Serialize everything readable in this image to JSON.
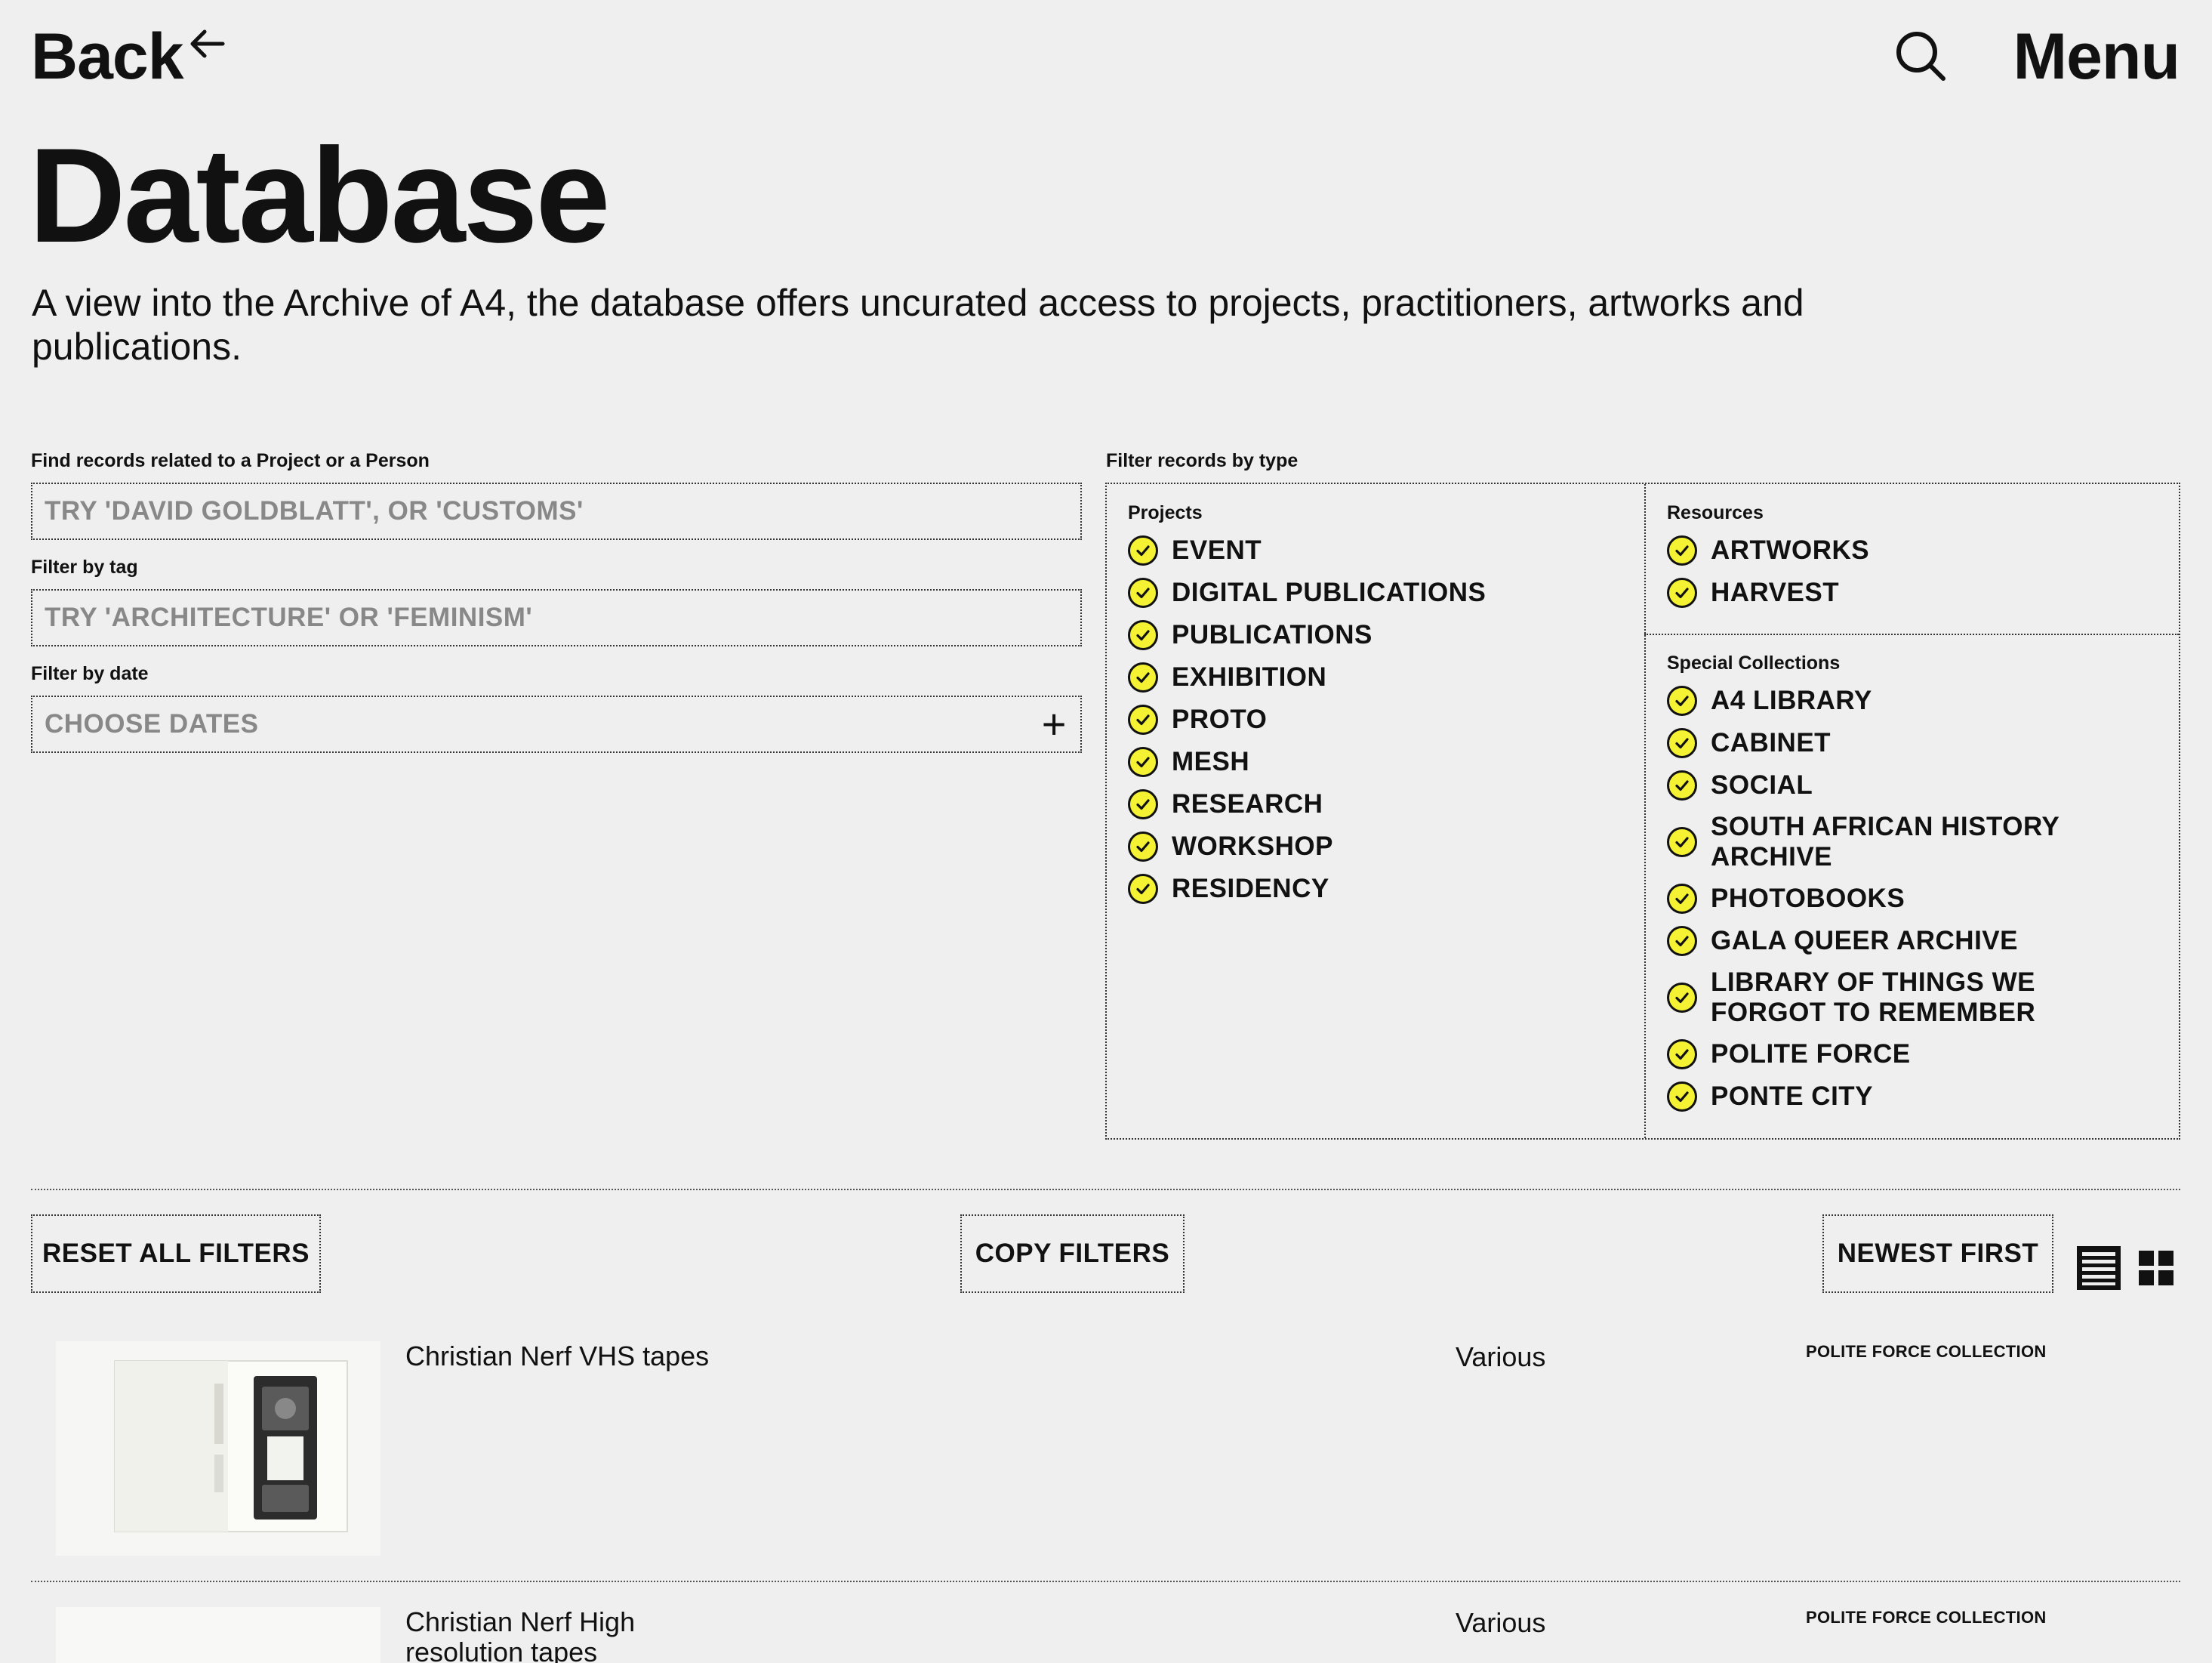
{
  "header": {
    "back_label": "Back",
    "menu_label": "Menu"
  },
  "page": {
    "title": "Database",
    "intro": "A view into the Archive of A4, the database offers uncurated access to projects, practitioners, artworks and publications."
  },
  "filters": {
    "related_label": "Find records related to a Project or a Person",
    "related_placeholder": "TRY 'DAVID GOLDBLATT', OR 'CUSTOMS'",
    "tag_label": "Filter by tag",
    "tag_placeholder": "TRY 'ARCHITECTURE' OR 'FEMINISM'",
    "date_label": "Filter by date",
    "date_placeholder": "CHOOSE DATES",
    "type_label": "Filter records by type",
    "projects": {
      "title": "Projects",
      "items": [
        "EVENT",
        "DIGITAL PUBLICATIONS",
        "PUBLICATIONS",
        "EXHIBITION",
        "PROTO",
        "MESH",
        "RESEARCH",
        "WORKSHOP",
        "RESIDENCY"
      ]
    },
    "resources": {
      "title": "Resources",
      "items": [
        "ARTWORKS",
        "HARVEST"
      ]
    },
    "special": {
      "title": "Special Collections",
      "items": [
        "A4 LIBRARY",
        "CABINET",
        "SOCIAL",
        "SOUTH AFRICAN HISTORY ARCHIVE",
        "PHOTOBOOKS",
        "GALA QUEER ARCHIVE",
        "LIBRARY OF THINGS WE FORGOT TO REMEMBER",
        "POLITE FORCE",
        "PONTE CITY"
      ]
    }
  },
  "toolbar": {
    "reset_label": "RESET ALL FILTERS",
    "copy_label": "COPY FILTERS",
    "sort_label": "NEWEST FIRST"
  },
  "records": [
    {
      "title": "Christian Nerf VHS tapes",
      "date": "Various",
      "collection": "POLITE FORCE COLLECTION"
    },
    {
      "title": "Christian Nerf High resolution tapes",
      "date": "Various",
      "collection": "POLITE FORCE COLLECTION"
    }
  ],
  "colors": {
    "background": "#efefef",
    "check_fill": "#f4f233",
    "text": "#111111",
    "placeholder": "#888888"
  }
}
